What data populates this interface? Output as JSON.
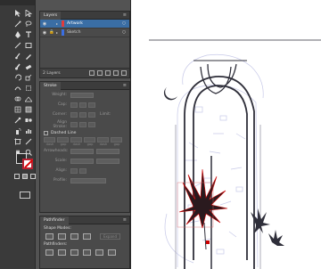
{
  "layers_panel": {
    "tab": "Layers",
    "menu_icon": "panel-menu-icon",
    "rows": [
      {
        "name": "Artwork",
        "color": "#e23b3b",
        "selected": true
      },
      {
        "name": "Sketch",
        "color": "#3b6fe2",
        "selected": false
      }
    ],
    "footer_count": "2 Layers"
  },
  "brushes_panel": {
    "tab": "Brushes",
    "basic_label": "Basic"
  },
  "stroke_panel": {
    "tab": "Stroke",
    "weight_label": "Weight:",
    "cap_label": "Cap:",
    "corner_label": "Corner:",
    "limit_label": "Limit:",
    "align_label": "Align Stroke:",
    "dashed_label": "Dashed Line",
    "dash_labels": [
      "dash",
      "gap",
      "dash",
      "gap",
      "dash",
      "gap"
    ],
    "arrowheads_label": "Arrowheads:",
    "scale_label": "Scale:",
    "align2_label": "Align:",
    "profile_label": "Profile:"
  },
  "pathfinder_panel": {
    "tab": "Pathfinder",
    "shape_modes_label": "Shape Modes:",
    "expand_label": "Expand",
    "pathfinders_label": "Pathfinders:"
  },
  "colors": {
    "selection_blue": "#3a6ea5",
    "stroke_red": "#d00000",
    "artwork_color": "#2f2f3a",
    "sketch_color": "#c7c9e8"
  }
}
